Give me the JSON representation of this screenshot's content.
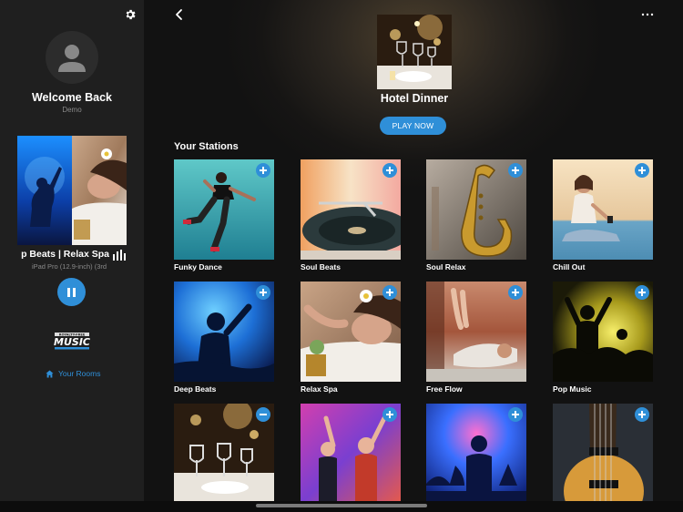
{
  "sidebar": {
    "welcome": "Welcome Back",
    "username": "Demo",
    "now_playing": {
      "title": "p Beats | Relax Spa",
      "device": "iPad Pro (12.9-inch) (3rd"
    },
    "logo": "ROYALTY-FREE MUSIC",
    "rooms_label": "Your Rooms",
    "icons": [
      "gear-icon",
      "avatar-icon",
      "equalizer-icon",
      "pause-icon",
      "home-icon"
    ]
  },
  "main": {
    "featured_title": "Hotel Dinner",
    "play_now": "PLAY NOW",
    "stations_heading": "Your Stations",
    "stations": [
      {
        "name": "Funky Dance",
        "added": false
      },
      {
        "name": "Soul Beats",
        "added": false
      },
      {
        "name": "Soul Relax",
        "added": false
      },
      {
        "name": "Chill Out",
        "added": false
      },
      {
        "name": "Deep Beats",
        "added": false
      },
      {
        "name": "Relax Spa",
        "added": false
      },
      {
        "name": "Free Flow",
        "added": false
      },
      {
        "name": "Pop Music",
        "added": false
      },
      {
        "name": "",
        "added": true
      },
      {
        "name": "",
        "added": false
      },
      {
        "name": "",
        "added": false
      },
      {
        "name": "",
        "added": false
      }
    ],
    "icons": [
      "back-chevron-icon",
      "more-dots-icon"
    ]
  },
  "colors": {
    "accent": "#2f8fd8",
    "sidebar_bg": "#1f1f1f",
    "main_bg": "#121212"
  }
}
